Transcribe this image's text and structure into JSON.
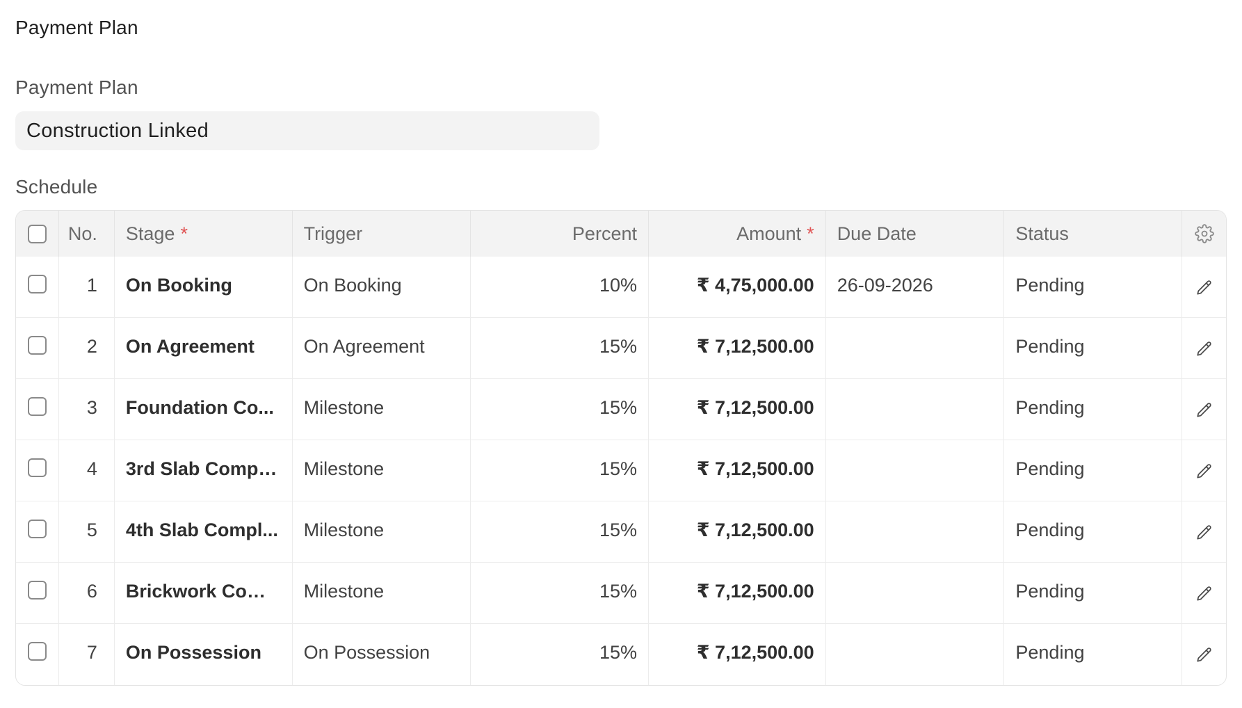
{
  "section": {
    "title": "Payment Plan"
  },
  "payment_plan": {
    "label": "Payment Plan",
    "value": "Construction Linked"
  },
  "schedule": {
    "label": "Schedule",
    "columns": {
      "no": "No.",
      "stage": "Stage",
      "trigger": "Trigger",
      "percent": "Percent",
      "amount": "Amount",
      "due_date": "Due Date",
      "status": "Status",
      "required_marker": "*"
    },
    "rows": [
      {
        "no": "1",
        "stage": "On Booking",
        "trigger": "On Booking",
        "percent": "10%",
        "amount": "₹ 4,75,000.00",
        "due_date": "26-09-2026",
        "status": "Pending"
      },
      {
        "no": "2",
        "stage": "On Agreement",
        "trigger": "On Agreement",
        "percent": "15%",
        "amount": "₹ 7,12,500.00",
        "due_date": "",
        "status": "Pending"
      },
      {
        "no": "3",
        "stage": "Foundation Co...",
        "trigger": "Milestone",
        "percent": "15%",
        "amount": "₹ 7,12,500.00",
        "due_date": "",
        "status": "Pending"
      },
      {
        "no": "4",
        "stage": "3rd Slab Compl...",
        "trigger": "Milestone",
        "percent": "15%",
        "amount": "₹ 7,12,500.00",
        "due_date": "",
        "status": "Pending"
      },
      {
        "no": "5",
        "stage": "4th Slab Compl...",
        "trigger": "Milestone",
        "percent": "15%",
        "amount": "₹ 7,12,500.00",
        "due_date": "",
        "status": "Pending"
      },
      {
        "no": "6",
        "stage": "Brickwork Com...",
        "trigger": "Milestone",
        "percent": "15%",
        "amount": "₹ 7,12,500.00",
        "due_date": "",
        "status": "Pending"
      },
      {
        "no": "7",
        "stage": "On Possession",
        "trigger": "On Possession",
        "percent": "15%",
        "amount": "₹ 7,12,500.00",
        "due_date": "",
        "status": "Pending"
      }
    ]
  },
  "icons": {
    "settings": "gear-icon",
    "edit": "pencil-icon"
  },
  "colors": {
    "required": "#e05252",
    "header_bg": "#f3f3f3",
    "field_bg": "#f3f3f3"
  }
}
